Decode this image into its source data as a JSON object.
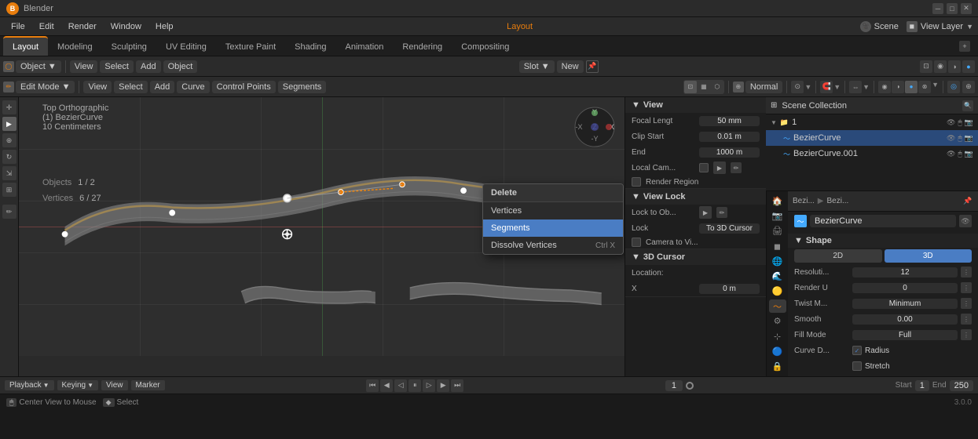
{
  "app": {
    "name": "Blender",
    "title": "Blender",
    "version": "3.0.0"
  },
  "title_bar": {
    "logo": "B",
    "title": "Blender",
    "minimize": "─",
    "maximize": "□",
    "close": "✕"
  },
  "menu_bar": {
    "items": [
      "File",
      "Edit",
      "Render",
      "Window",
      "Help"
    ]
  },
  "workspace_tabs": {
    "items": [
      "Layout",
      "Modeling",
      "Sculpting",
      "UV Editing",
      "Texture Paint",
      "Shading",
      "Animation",
      "Rendering",
      "Compositing"
    ],
    "active": "Layout"
  },
  "header_toolbar": {
    "mode": "Object",
    "view": "View",
    "select": "Select",
    "add": "Add",
    "object": "Object",
    "slot": "Slot",
    "new": "New",
    "scene": "Scene",
    "view_layer": "View Layer"
  },
  "edit_toolbar": {
    "mode": "Edit Mode",
    "view": "View",
    "select": "Select",
    "add": "Add",
    "curve": "Curve",
    "control_points": "Control Points",
    "segments": "Segments",
    "transform": "Normal",
    "snapping": "Normal"
  },
  "viewport": {
    "title": "Top Orthographic",
    "object_name": "(1) BezierCurve",
    "unit": "10 Centimeters",
    "objects_label": "Objects",
    "objects_value": "1 / 2",
    "vertices_label": "Vertices",
    "vertices_value": "6 / 27"
  },
  "context_menu": {
    "header": "Delete",
    "items": [
      {
        "label": "Vertices",
        "shortcut": ""
      },
      {
        "label": "Segments",
        "shortcut": ""
      },
      {
        "label": "Dissolve Vertices",
        "shortcut": "Ctrl X"
      }
    ],
    "active_item": "Segments"
  },
  "sidebar_right": {
    "view_section": {
      "label": "View",
      "focal_length_label": "Focal Lengt",
      "focal_length_value": "50 mm",
      "clip_start_label": "Clip Start",
      "clip_start_value": "0.01 m",
      "end_label": "End",
      "end_value": "1000 m",
      "local_cam_label": "Local Cam...",
      "render_region_label": "Render Region"
    },
    "view_lock_section": {
      "label": "View Lock",
      "lock_to_label": "Lock to Ob...",
      "lock_label": "Lock",
      "lock_value": "To 3D Cursor",
      "camera_label": "Camera to Vi..."
    },
    "cursor_section": {
      "label": "3D Cursor",
      "location_label": "Location:",
      "x_label": "X",
      "x_value": "0 m"
    }
  },
  "outliner": {
    "title": "Scene Collection",
    "items": [
      {
        "label": "1",
        "indent": 0,
        "type": "collection",
        "expanded": true
      },
      {
        "label": "BezierCurve",
        "indent": 1,
        "type": "curve",
        "active": true
      },
      {
        "label": "BezierCurve.001",
        "indent": 1,
        "type": "curve",
        "active": false
      }
    ]
  },
  "properties": {
    "active_icon": "curve",
    "object_name": "BezierCurve",
    "shape_section": {
      "label": "Shape",
      "2d_label": "2D",
      "3d_label": "3D",
      "active_mode": "3D",
      "resolution_label": "Resoluti...",
      "resolution_value": "12",
      "render_u_label": "Render U",
      "render_u_value": "0",
      "twist_label": "Twist M...",
      "twist_value": "Minimum",
      "smooth_label": "Smooth",
      "smooth_value": "0.00",
      "fill_mode_label": "Fill Mode",
      "fill_mode_value": "Full",
      "curve_d_label": "Curve D...",
      "radius_label": "Radius",
      "radius_checked": true,
      "stretch_label": "Stretch"
    }
  },
  "bottom_bar": {
    "playback": "Playback",
    "keying": "Keying",
    "view": "View",
    "marker": "Marker",
    "start_label": "Start",
    "start_value": "1",
    "end_label": "End",
    "end_value": "250",
    "frame_value": "1"
  },
  "status_bar": {
    "mouse_icon": "🖱",
    "center_view": "Center View to Mouse",
    "select_icon": "◆",
    "select": "Select",
    "version": "3.0.0"
  },
  "props_icons": [
    "🏠",
    "📷",
    "🟢",
    "🔺",
    "〇",
    "🔵",
    "⚙",
    "🔧",
    "🌐",
    "🌊",
    "🔒",
    "⚡"
  ]
}
